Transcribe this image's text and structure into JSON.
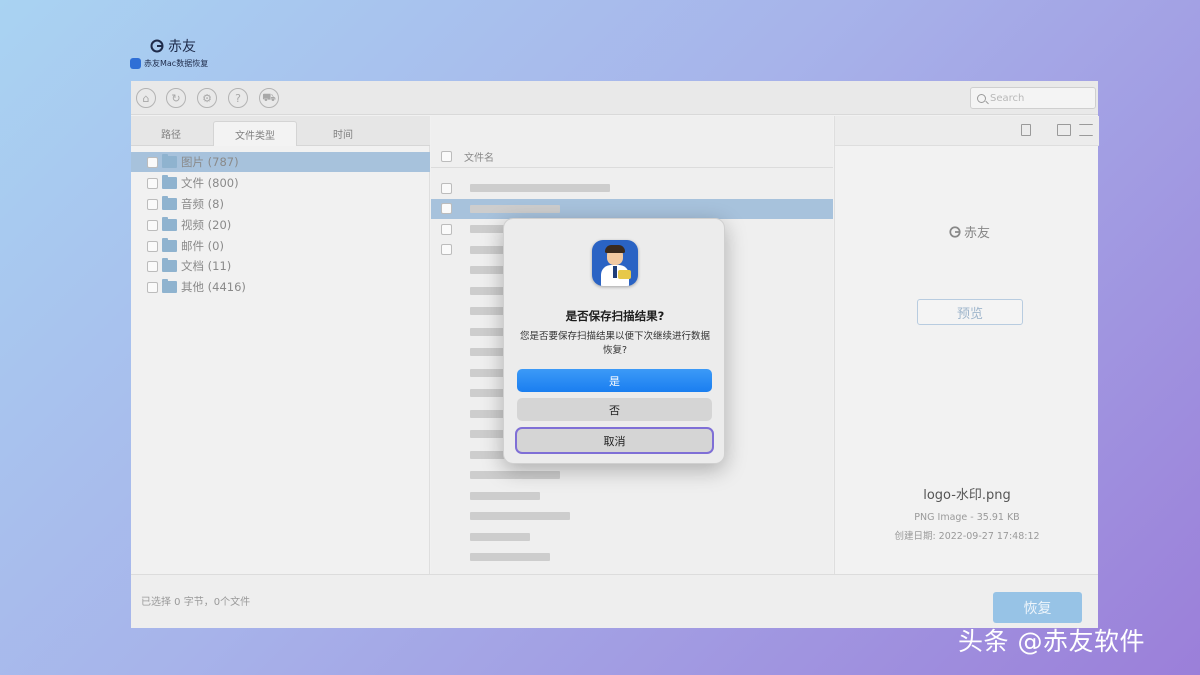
{
  "brand": {
    "logo_text": "赤友",
    "app_name": "赤友Mac数据恢复"
  },
  "toolbar": {
    "icons": [
      "home-icon",
      "scan-icon",
      "settings-icon",
      "help-icon",
      "cart-icon"
    ],
    "search_placeholder": "Search"
  },
  "left_panel": {
    "tabs": [
      {
        "label": "路径",
        "active": false
      },
      {
        "label": "文件类型",
        "active": true
      },
      {
        "label": "时间",
        "active": false
      }
    ],
    "tree": [
      {
        "label": "图片 (787)",
        "selected": true
      },
      {
        "label": "文件 (800)",
        "selected": false
      },
      {
        "label": "音频 (8)",
        "selected": false
      },
      {
        "label": "视频 (20)",
        "selected": false
      },
      {
        "label": "邮件 (0)",
        "selected": false
      },
      {
        "label": "文档 (11)",
        "selected": false
      },
      {
        "label": "其他 (4416)",
        "selected": false
      }
    ]
  },
  "file_list": {
    "header": "文件名"
  },
  "preview": {
    "logo_text": "赤友",
    "preview_label": "预览",
    "file_name": "logo-水印.png",
    "file_type": "PNG Image - 35.91 KB",
    "created": "创建日期: 2022-09-27 17:48:12"
  },
  "status_bar": {
    "text": "已选择 0 字节，0个文件",
    "recover_label": "恢复"
  },
  "dialog": {
    "title": "是否保存扫描结果?",
    "message": "您是否要保存扫描结果以便下次继续进行数据恢复?",
    "yes_label": "是",
    "no_label": "否",
    "cancel_label": "取消"
  },
  "watermark": "头条 @赤友软件",
  "colors": {
    "accent_blue": "#1a7ef0",
    "selection": "#a7c2dc",
    "focus_ring": "#7f6fd6"
  }
}
